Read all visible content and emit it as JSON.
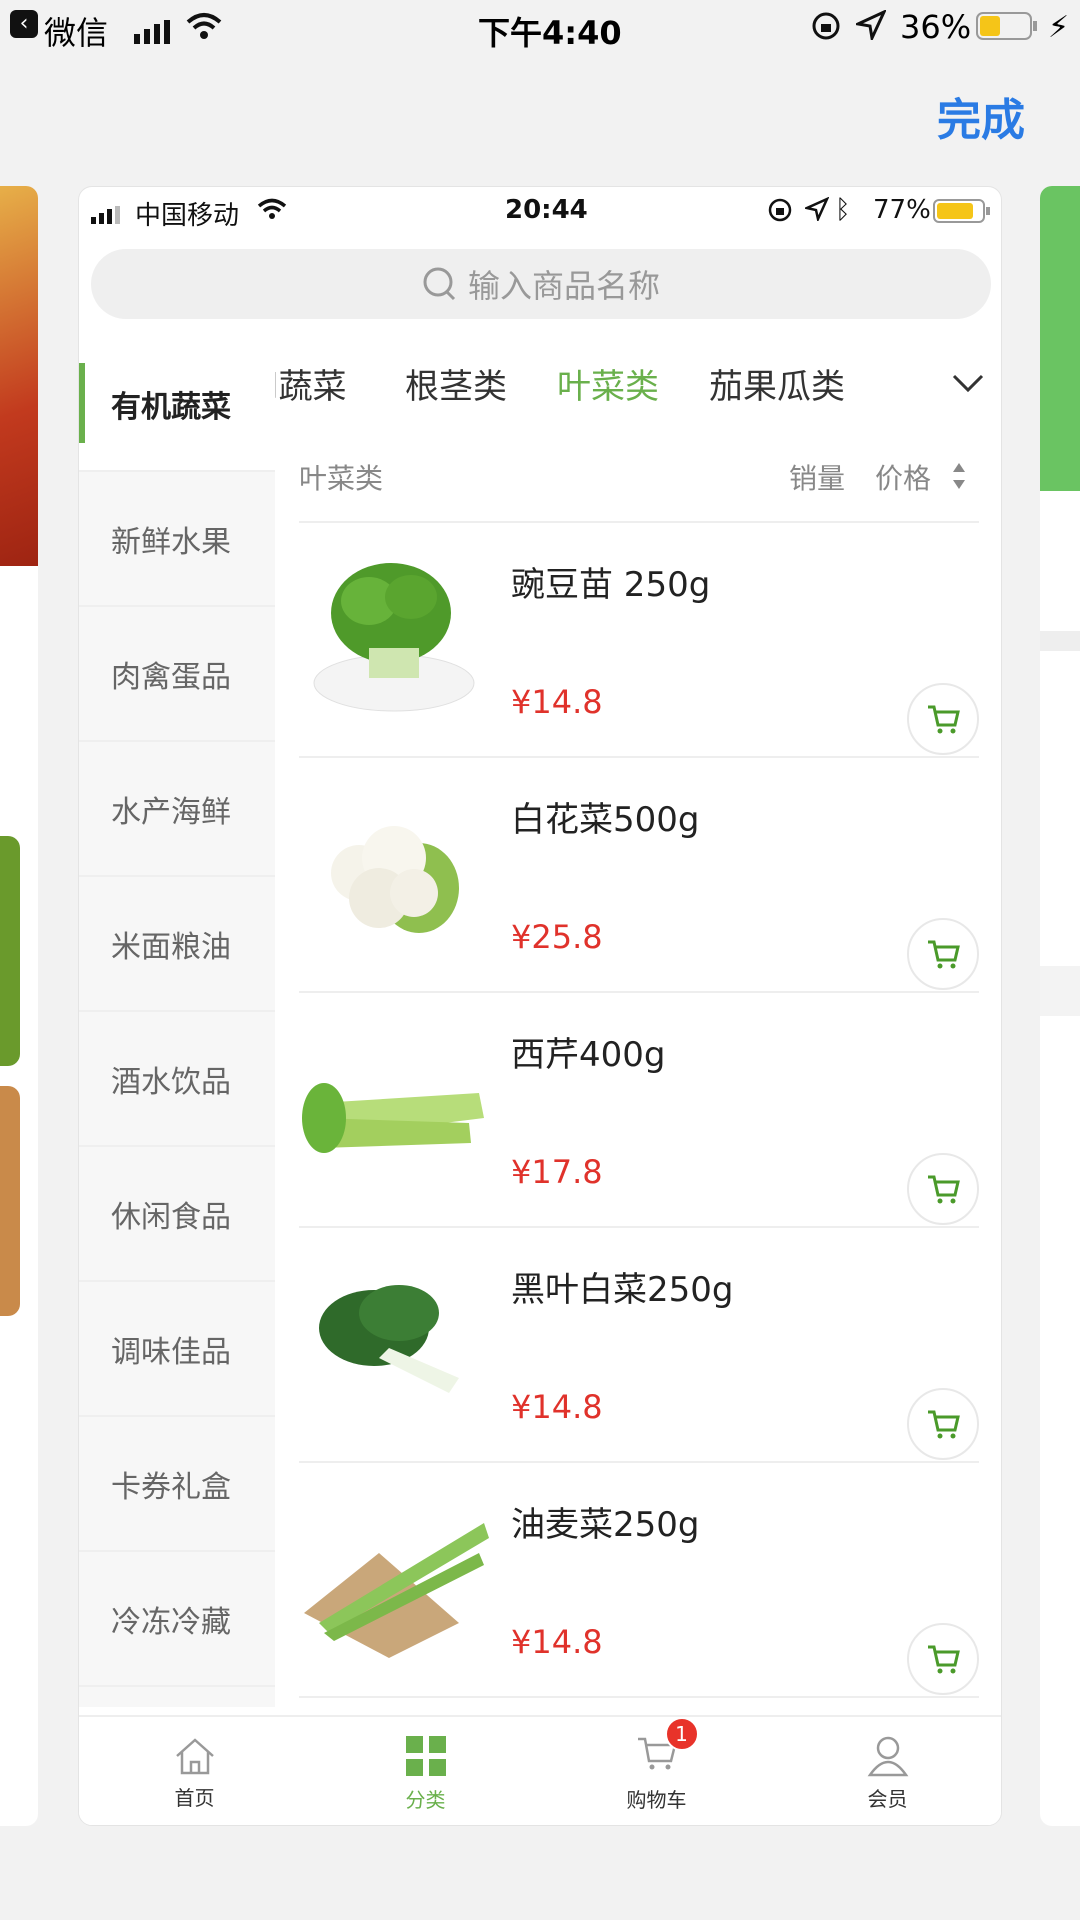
{
  "outer_status": {
    "back_app": "微信",
    "time": "下午4:40",
    "battery": "36%"
  },
  "done_label": "完成",
  "inner_status": {
    "carrier": "中国移动",
    "time": "20:44",
    "battery": "77%"
  },
  "search": {
    "placeholder": "输入商品名称"
  },
  "top_tabs": [
    {
      "label": "l蔬菜"
    },
    {
      "label": "根茎类"
    },
    {
      "label": "叶菜类",
      "active": true
    },
    {
      "label": "茄果瓜类"
    }
  ],
  "sidebar": {
    "items": [
      {
        "label": "有机蔬菜",
        "active": true
      },
      {
        "label": "新鲜水果"
      },
      {
        "label": "肉禽蛋品"
      },
      {
        "label": "水产海鲜"
      },
      {
        "label": "米面粮油"
      },
      {
        "label": "酒水饮品"
      },
      {
        "label": "休闲食品"
      },
      {
        "label": "调味佳品"
      },
      {
        "label": "卡券礼盒"
      },
      {
        "label": "冷冻冷藏"
      }
    ]
  },
  "list_header": {
    "category": "叶菜类",
    "sort_sales": "销量",
    "sort_price": "价格"
  },
  "products": [
    {
      "name": "豌豆苗 250g",
      "price": "¥14.8"
    },
    {
      "name": "白花菜500g",
      "price": "¥25.8"
    },
    {
      "name": "西芹400g",
      "price": "¥17.8"
    },
    {
      "name": "黑叶白菜250g",
      "price": "¥14.8"
    },
    {
      "name": "油麦菜250g",
      "price": "¥14.8"
    }
  ],
  "tabbar": {
    "items": [
      {
        "label": "首页",
        "icon": "home-icon"
      },
      {
        "label": "分类",
        "icon": "grid-icon",
        "active": true
      },
      {
        "label": "购物车",
        "icon": "cart-icon",
        "badge": "1"
      },
      {
        "label": "会员",
        "icon": "user-icon"
      }
    ]
  },
  "colors": {
    "accent": "#6ab04c",
    "price": "#e0322b",
    "done": "#2a7be4"
  }
}
